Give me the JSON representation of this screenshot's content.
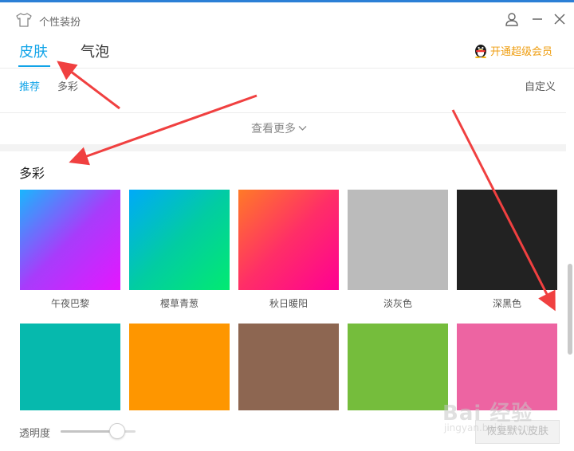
{
  "window": {
    "title": "个性装扮"
  },
  "tabs": [
    {
      "label": "皮肤",
      "active": true
    },
    {
      "label": "气泡",
      "active": false
    }
  ],
  "vip": {
    "label": "开通超级会员"
  },
  "subtabs": [
    {
      "label": "推荐",
      "active": true
    },
    {
      "label": "多彩",
      "active": false
    }
  ],
  "custom": {
    "label": "自定义"
  },
  "see_more": {
    "label": "查看更多"
  },
  "section": {
    "title": "多彩"
  },
  "swatches": [
    {
      "label": "午夜巴黎",
      "gradient": [
        "#19b6fd",
        "#a73cfb",
        "#e516ff"
      ]
    },
    {
      "label": "樱草青葱",
      "gradient": [
        "#00aaf8",
        "#02cca3",
        "#02ea71"
      ]
    },
    {
      "label": "秋日暖阳",
      "gradient": [
        "#ff7a27",
        "#ff2e67",
        "#ff0093"
      ]
    },
    {
      "label": "淡灰色",
      "color": "#bbbbbb"
    },
    {
      "label": "深黑色",
      "color": "#222222"
    },
    {
      "label": "",
      "color": "#06b9ad"
    },
    {
      "label": "",
      "color": "#fe9600"
    },
    {
      "label": "",
      "color": "#8d6651"
    },
    {
      "label": "",
      "color": "#75bd3c"
    },
    {
      "label": "",
      "color": "#ed64a2"
    }
  ],
  "bottom": {
    "opacity_label": "透明度",
    "opacity_value": 0.75,
    "restore_label": "恢复默认皮肤"
  },
  "watermark": {
    "logo": "Bai 经验",
    "sub": "jingyan.baidu.com"
  },
  "colors": {
    "accent": "#12a4e8",
    "vip": "#ef9e11",
    "arrow": "#f04040"
  }
}
